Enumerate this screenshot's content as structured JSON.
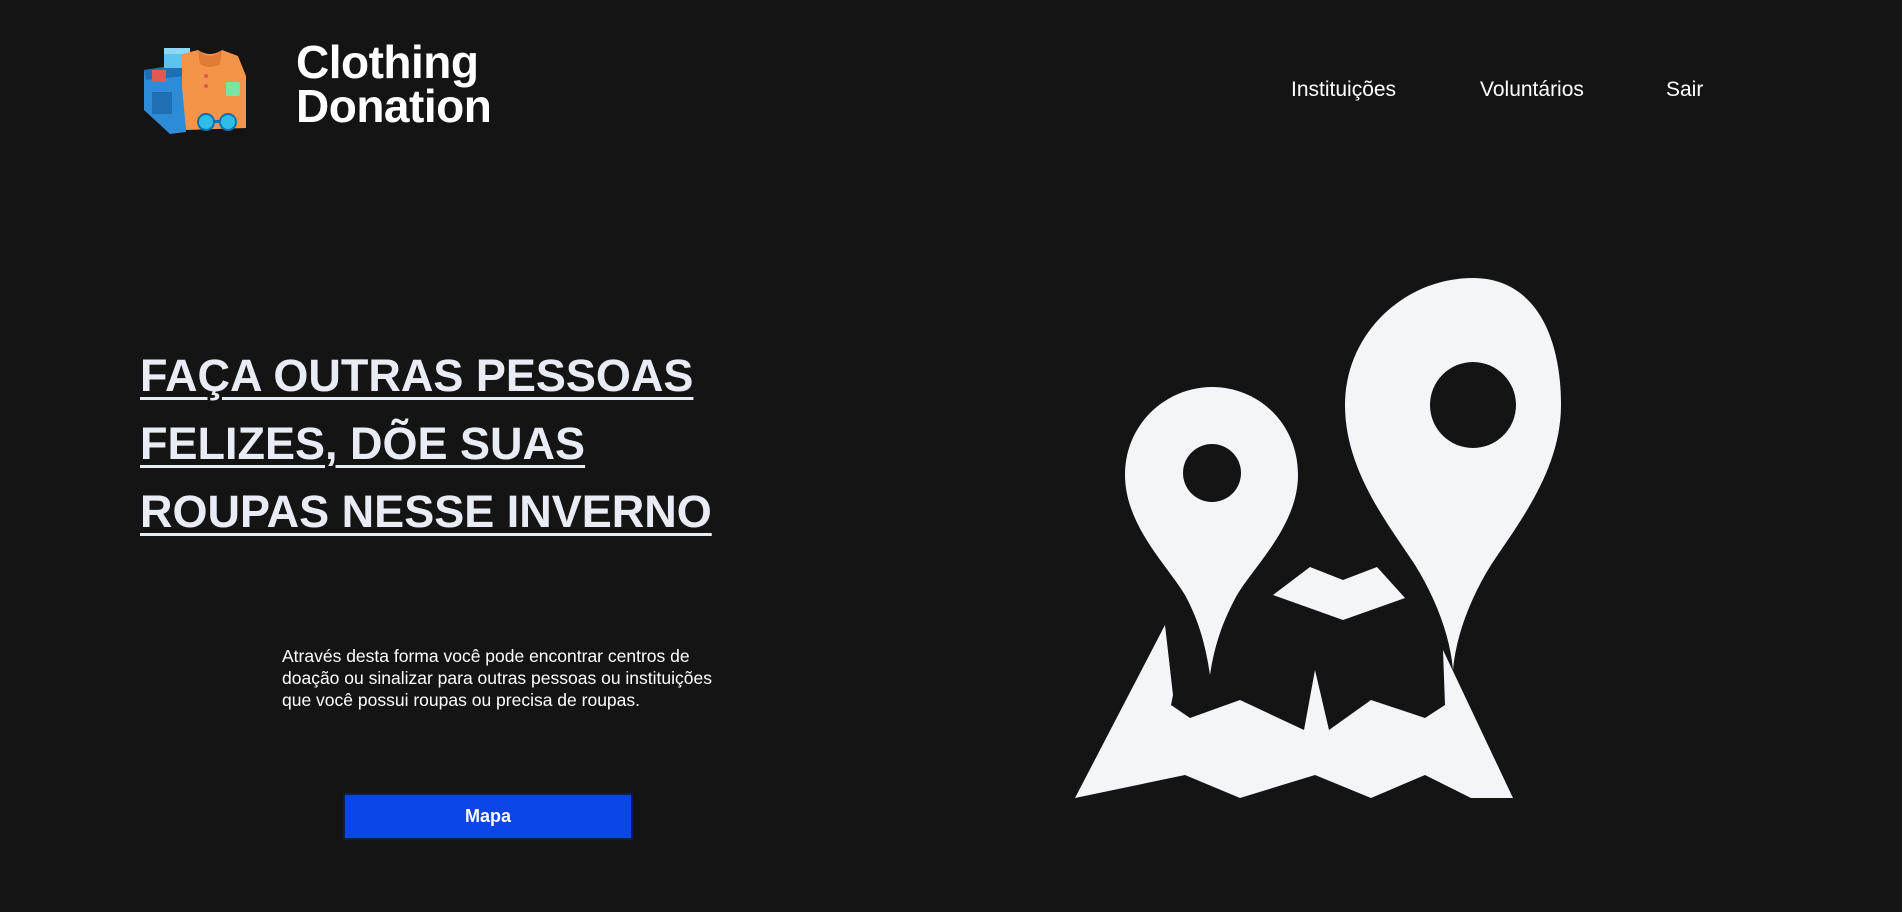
{
  "header": {
    "brand_line1": "Clothing",
    "brand_line2": "Donation",
    "logo_icon": "clothes-donation-logo-icon"
  },
  "nav": {
    "items": [
      {
        "label": "Instituições"
      },
      {
        "label": "Voluntários"
      },
      {
        "label": "Sair"
      }
    ]
  },
  "hero": {
    "title": "FAÇA OUTRAS PESSOAS FELIZES, DÕE SUAS ROUPAS NESSE INVERNO",
    "description": "Através desta forma você pode encontrar centros de doação ou sinalizar para outras pessoas ou instituições que você possui roupas ou precisa de roupas.",
    "button_label": "Mapa",
    "illustration_icon": "map-pins-icon"
  },
  "colors": {
    "background": "#141414",
    "button": "#0a45e8",
    "text": "#ffffff",
    "illustration": "#f4f5f9"
  }
}
